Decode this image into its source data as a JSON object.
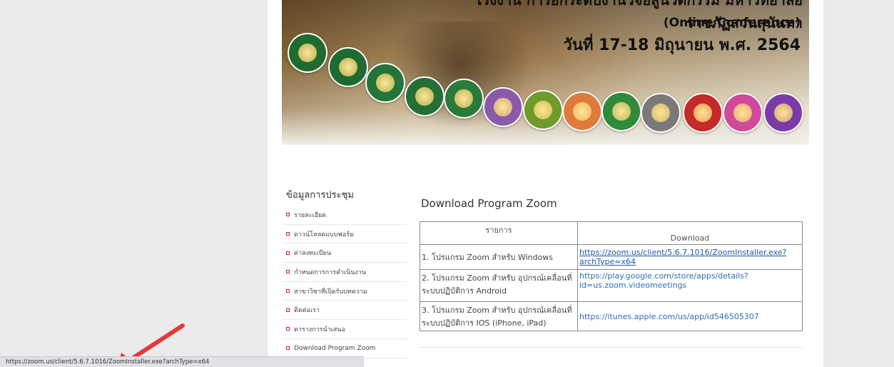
{
  "banner": {
    "line1": "โรงงาน การยกระดับงานวิจัยสู่นวัตกรรม มหาวิทยาลัยราชภัฏสวนสุนันทา",
    "line2": "(Online Conference)",
    "line3": "วันที่ 17-18 มิถุนายน พ.ศ. 2564",
    "seals": [
      {
        "color": "#1f6b2e"
      },
      {
        "color": "#1e6a30"
      },
      {
        "color": "#24733a"
      },
      {
        "color": "#256f36"
      },
      {
        "color": "#2c7a3b"
      },
      {
        "color": "#8a5aa8"
      },
      {
        "color": "#6f9a2c"
      },
      {
        "color": "#e07a3c"
      },
      {
        "color": "#2f8a3a"
      },
      {
        "color": "#7a7a7a"
      },
      {
        "color": "#c42a2a"
      },
      {
        "color": "#d04a9a"
      },
      {
        "color": "#7a3aa8"
      }
    ]
  },
  "sidebar": {
    "title": "ข้อมูลการประชุม",
    "items": [
      {
        "label": "รายละเอียด"
      },
      {
        "label": "ดาวน์โหลดแบบฟอร์ม"
      },
      {
        "label": "ค่าลงทะเบียน"
      },
      {
        "label": "กำหนดการการดำเนินงาน"
      },
      {
        "label": "สาขาวิชาที่เปิดรับบทความ"
      },
      {
        "label": "ติดต่อเรา"
      },
      {
        "label": "ตารางการนำเสนอ"
      },
      {
        "label": "Download Program Zoom"
      }
    ]
  },
  "main": {
    "title": "Download Program Zoom",
    "table": {
      "headers": [
        "รายการ",
        "Download"
      ],
      "rows": [
        {
          "item": "1. โปรแกรม Zoom สำหรับ Windows",
          "link": "https://zoom.us/client/5.6.7.1016/ZoomInstaller.exe?archType=x64"
        },
        {
          "item": "2. โปรแกรม Zoom สำหรับ อุปกรณ์เคลื่อนที่ ระบบปฏิบัติการ Android",
          "link": "https://play.google.com/store/apps/details?id=us.zoom.videomeetings"
        },
        {
          "item": "3. โปรแกรม Zoom สำหรับ อุปกรณ์เคลื่อนที่ ระบบปฏิบัติการ IOS (iPhone, iPad)",
          "link": "https://itunes.apple.com/us/app/id546505307"
        }
      ]
    }
  },
  "statusbar": {
    "url": "https://zoom.us/client/5.6.7.1016/ZoomInstaller.exe?archType=x64"
  },
  "colors": {
    "accent_red": "#e23a3a",
    "link": "#2a6ebb",
    "bullet": "#d3212c"
  },
  "annotation": {
    "icon": "red-arrow-icon"
  }
}
